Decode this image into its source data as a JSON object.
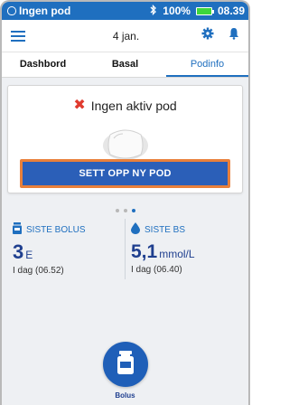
{
  "status_bar": {
    "title": "Ingen pod",
    "battery_percent": "100%",
    "time": "08.39",
    "colors": {
      "bar": "#1f6fbf",
      "battery": "#3dd63d"
    }
  },
  "header": {
    "date": "4 jan."
  },
  "tabs": [
    {
      "label": "Dashbord",
      "active": false
    },
    {
      "label": "Basal",
      "active": false
    },
    {
      "label": "Podinfo",
      "active": true
    }
  ],
  "pod_card": {
    "title": "Ingen aktiv pod",
    "setup_button": "SETT OPP NY POD",
    "highlight_color": "#e9803b"
  },
  "pager": {
    "count": 3,
    "active_index": 2
  },
  "stats": {
    "bolus": {
      "label": "SISTE BOLUS",
      "value": "3",
      "unit": "E",
      "sub": "I dag (06.52)"
    },
    "bg": {
      "label": "SISTE BS",
      "value": "5,1",
      "unit": "mmol/L",
      "sub": "I dag (06.40)"
    }
  },
  "bolus_button": {
    "label": "Bolus"
  }
}
